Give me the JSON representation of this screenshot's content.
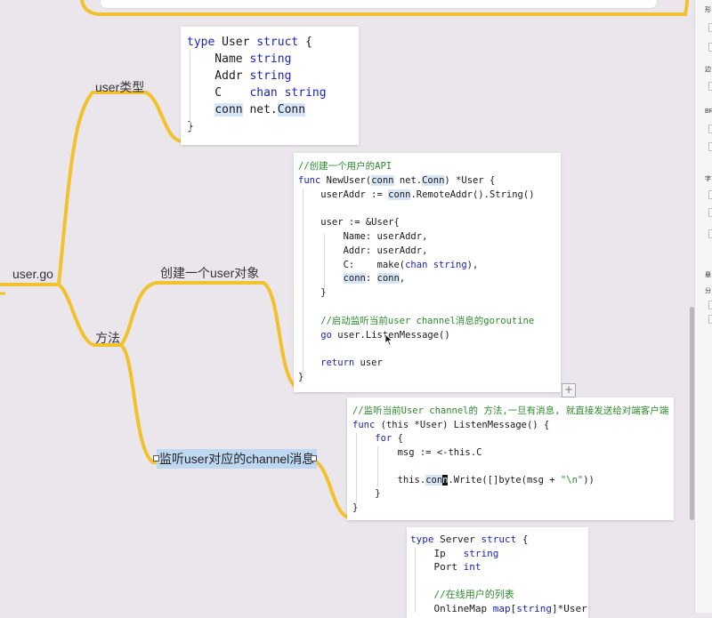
{
  "mindmap": {
    "root": "user.go",
    "user_type": "user类型",
    "methods": "方法",
    "create_user": "创建一个user对象",
    "listen_channel": "监听user对应的channel消息"
  },
  "code_user_struct": {
    "lines": [
      [
        [
          "kw",
          "type"
        ],
        [
          "t",
          " User "
        ],
        [
          "kw",
          "struct"
        ],
        [
          "t",
          " {"
        ]
      ],
      [
        [
          "t",
          "    Name "
        ],
        [
          "kw",
          "string"
        ]
      ],
      [
        [
          "t",
          "    Addr "
        ],
        [
          "kw",
          "string"
        ]
      ],
      [
        [
          "t",
          "    C    "
        ],
        [
          "kw",
          "chan string"
        ]
      ],
      [
        [
          "t",
          "    "
        ],
        [
          "hl",
          "conn"
        ],
        [
          "t",
          " net."
        ],
        [
          "hl",
          "Conn"
        ]
      ],
      [
        [
          "t",
          "}"
        ]
      ]
    ]
  },
  "code_new_user": {
    "lines": [
      [
        [
          "cm",
          "//创建一个用户的API"
        ]
      ],
      [
        [
          "kw",
          "func"
        ],
        [
          "t",
          " NewUser("
        ],
        [
          "hl",
          "conn"
        ],
        [
          "t",
          " net."
        ],
        [
          "hl",
          "Conn"
        ],
        [
          "t",
          ") *User {"
        ]
      ],
      [
        [
          "t",
          "    userAddr := "
        ],
        [
          "hl",
          "conn"
        ],
        [
          "t",
          ".RemoteAddr().String()"
        ]
      ],
      [
        [
          "t",
          ""
        ]
      ],
      [
        [
          "t",
          "    user := &User{"
        ]
      ],
      [
        [
          "t",
          "        Name: userAddr,"
        ]
      ],
      [
        [
          "t",
          "        Addr: userAddr,"
        ]
      ],
      [
        [
          "t",
          "        C:    make("
        ],
        [
          "kw",
          "chan string"
        ],
        [
          "t",
          "),"
        ]
      ],
      [
        [
          "t",
          "        "
        ],
        [
          "hl",
          "conn"
        ],
        [
          "t",
          ": "
        ],
        [
          "hl",
          "conn"
        ],
        [
          "t",
          ","
        ]
      ],
      [
        [
          "t",
          "    }"
        ]
      ],
      [
        [
          "t",
          ""
        ]
      ],
      [
        [
          "cm",
          "    //启动监听当前user channel消息的goroutine"
        ]
      ],
      [
        [
          "kw",
          "    go"
        ],
        [
          "t",
          " user.ListenMessage()"
        ]
      ],
      [
        [
          "t",
          ""
        ]
      ],
      [
        [
          "kw",
          "    return"
        ],
        [
          "t",
          " user"
        ]
      ],
      [
        [
          "t",
          "}"
        ]
      ]
    ]
  },
  "code_listen": {
    "lines": [
      [
        [
          "cm",
          "//监听当前User channel的 方法,一旦有消息, 就直接发送给对端客户端"
        ]
      ],
      [
        [
          "kw",
          "func"
        ],
        [
          "t",
          " (this *User) ListenMessage() {"
        ]
      ],
      [
        [
          "kw",
          "    for"
        ],
        [
          "t",
          " {"
        ]
      ],
      [
        [
          "t",
          "        msg := <-this.C"
        ]
      ],
      [
        [
          "t",
          ""
        ]
      ],
      [
        [
          "t",
          "        this."
        ],
        [
          "hl",
          "con"
        ],
        [
          "cursor",
          "n"
        ],
        [
          "t",
          ".Write([]byte(msg + "
        ],
        [
          "cm",
          "\"\\n\""
        ],
        [
          "t",
          "))"
        ]
      ],
      [
        [
          "t",
          "    }"
        ]
      ],
      [
        [
          "t",
          "}"
        ]
      ]
    ]
  },
  "code_server": {
    "lines": [
      [
        [
          "kw",
          "type"
        ],
        [
          "t",
          " Server "
        ],
        [
          "kw",
          "struct"
        ],
        [
          "t",
          " {"
        ]
      ],
      [
        [
          "t",
          "    Ip   "
        ],
        [
          "kw",
          "string"
        ]
      ],
      [
        [
          "t",
          "    Port "
        ],
        [
          "kw",
          "int"
        ]
      ],
      [
        [
          "t",
          ""
        ]
      ],
      [
        [
          "cm",
          "    //在线用户的列表"
        ]
      ],
      [
        [
          "t",
          "    OnlineMap "
        ],
        [
          "kw",
          "map"
        ],
        [
          "t",
          "["
        ],
        [
          "kw",
          "string"
        ],
        [
          "t",
          "]*User"
        ]
      ]
    ]
  },
  "right_panel": {
    "labels": [
      "形",
      "边",
      "BR",
      "字",
      "悬",
      "分"
    ]
  },
  "add_button": "+",
  "colors": {
    "branch": "#f2c12e",
    "background": "#eae6ec"
  }
}
